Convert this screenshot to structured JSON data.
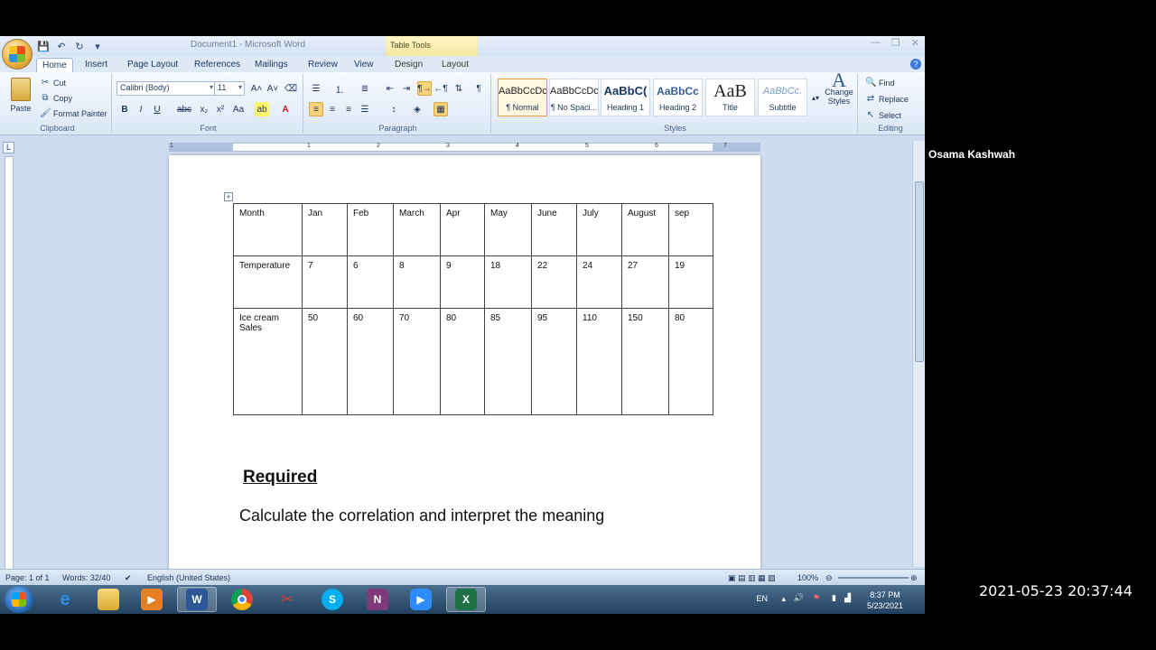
{
  "window": {
    "title": "Document1 - Microsoft Word",
    "contextual_tab_label": "Table Tools"
  },
  "tabs": [
    "Home",
    "Insert",
    "Page Layout",
    "References",
    "Mailings",
    "Review",
    "View"
  ],
  "contextual_tabs": [
    "Design",
    "Layout"
  ],
  "ribbon": {
    "clipboard": {
      "label": "Clipboard",
      "paste": "Paste",
      "cut": "Cut",
      "copy": "Copy",
      "format_painter": "Format Painter"
    },
    "font": {
      "label": "Font",
      "font_name": "Calibri (Body)",
      "font_size": "11"
    },
    "paragraph": {
      "label": "Paragraph"
    },
    "styles": {
      "label": "Styles",
      "items": [
        {
          "sample": "AaBbCcDc",
          "name": "¶ Normal"
        },
        {
          "sample": "AaBbCcDc",
          "name": "¶ No Spaci..."
        },
        {
          "sample": "AaBbC(",
          "name": "Heading 1"
        },
        {
          "sample": "AaBbCc",
          "name": "Heading 2"
        },
        {
          "sample": "AaB",
          "name": "Title"
        },
        {
          "sample": "AaBbCc.",
          "name": "Subtitle"
        }
      ],
      "change_styles": "Change Styles"
    },
    "editing": {
      "label": "Editing",
      "find": "Find",
      "replace": "Replace",
      "select": "Select"
    }
  },
  "ruler": {
    "numbers": [
      "1",
      "1",
      "2",
      "3",
      "4",
      "5",
      "6",
      "7"
    ]
  },
  "document": {
    "table": [
      [
        "Month",
        "Jan",
        "Feb",
        "March",
        "Apr",
        "May",
        "June",
        "July",
        "August",
        "sep"
      ],
      [
        "Temperature",
        "7",
        "6",
        "8",
        "9",
        "18",
        "22",
        "24",
        "27",
        "19"
      ],
      [
        "Ice cream Sales",
        "50",
        "60",
        "70",
        "80",
        "85",
        "95",
        "110",
        "150",
        "80"
      ]
    ],
    "required": "Required",
    "instruction": "Calculate the correlation and interpret the meaning"
  },
  "status": {
    "page": "Page: 1 of 1",
    "words": "Words: 32/40",
    "language": "English (United States)",
    "zoom": "100%"
  },
  "taskbar": {
    "apps": [
      "internet-explorer",
      "file-explorer",
      "media-player",
      "word",
      "chrome",
      "snipping-tool",
      "skype",
      "onenote",
      "zoom",
      "excel"
    ],
    "language": "EN",
    "time": "8:37 PM",
    "date": "5/23/2021"
  },
  "overlay": {
    "presenter_name": "Osama Kashwah",
    "recording_timestamp": "2021-05-23 20:37:44"
  }
}
